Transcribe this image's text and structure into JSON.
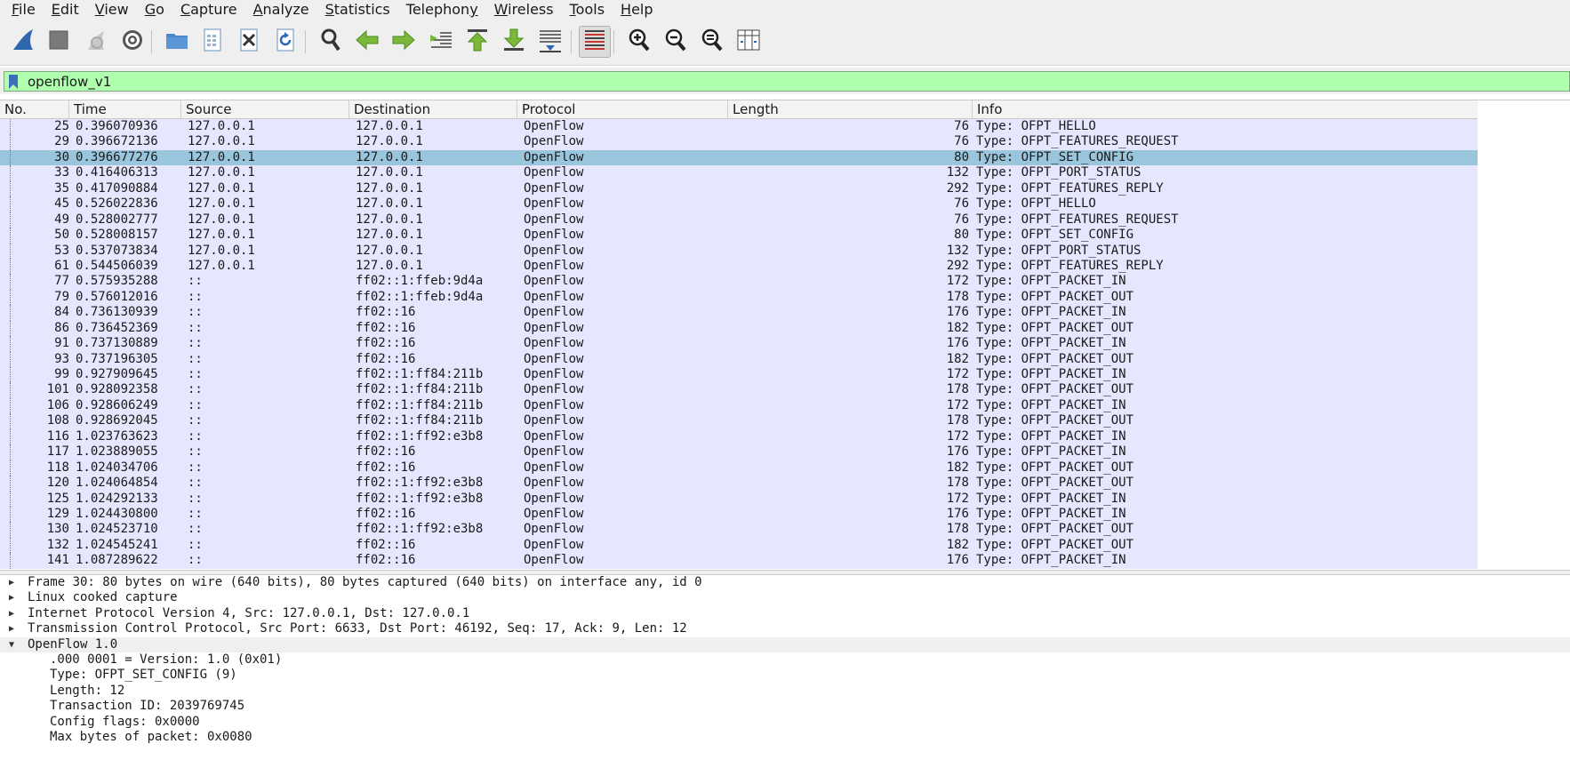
{
  "menu": [
    {
      "label": "File",
      "u": "F",
      "rest": "ile"
    },
    {
      "label": "Edit",
      "u": "E",
      "rest": "dit"
    },
    {
      "label": "View",
      "u": "V",
      "rest": "iew"
    },
    {
      "label": "Go",
      "u": "G",
      "rest": "o"
    },
    {
      "label": "Capture",
      "u": "C",
      "rest": "apture"
    },
    {
      "label": "Analyze",
      "u": "A",
      "rest": "nalyze"
    },
    {
      "label": "Statistics",
      "u": "S",
      "rest": "tatistics"
    },
    {
      "label": "Telephony",
      "u": "y",
      "pre": "Telephon",
      "rest": ""
    },
    {
      "label": "Wireless",
      "u": "W",
      "rest": "ireless"
    },
    {
      "label": "Tools",
      "u": "T",
      "rest": "ools"
    },
    {
      "label": "Help",
      "u": "H",
      "rest": "elp"
    }
  ],
  "toolbar_icons": [
    "shark-fin-start-icon",
    "stop-icon",
    "restart-icon",
    "capture-options-icon",
    "open-file-icon",
    "save-file-icon",
    "close-file-icon",
    "reload-icon",
    "find-packet-icon",
    "go-back-icon",
    "go-forward-icon",
    "go-to-packet-icon",
    "first-packet-icon",
    "last-packet-icon",
    "autoscroll-icon",
    "colorize-icon",
    "zoom-in-icon",
    "zoom-out-icon",
    "normal-size-icon",
    "resize-columns-icon"
  ],
  "filter": {
    "value": "openflow_v1"
  },
  "columns": [
    "No.",
    "Time",
    "Source",
    "Destination",
    "Protocol",
    "Length",
    "Info"
  ],
  "packets": [
    {
      "no": "25",
      "time": "0.396070936",
      "src": "127.0.0.1",
      "dst": "127.0.0.1",
      "proto": "OpenFlow",
      "len": "76",
      "info": "Type: OFPT_HELLO"
    },
    {
      "no": "29",
      "time": "0.396672136",
      "src": "127.0.0.1",
      "dst": "127.0.0.1",
      "proto": "OpenFlow",
      "len": "76",
      "info": "Type: OFPT_FEATURES_REQUEST"
    },
    {
      "no": "30",
      "time": "0.396677276",
      "src": "127.0.0.1",
      "dst": "127.0.0.1",
      "proto": "OpenFlow",
      "len": "80",
      "info": "Type: OFPT_SET_CONFIG",
      "selected": true
    },
    {
      "no": "33",
      "time": "0.416406313",
      "src": "127.0.0.1",
      "dst": "127.0.0.1",
      "proto": "OpenFlow",
      "len": "132",
      "info": "Type: OFPT_PORT_STATUS"
    },
    {
      "no": "35",
      "time": "0.417090884",
      "src": "127.0.0.1",
      "dst": "127.0.0.1",
      "proto": "OpenFlow",
      "len": "292",
      "info": "Type: OFPT_FEATURES_REPLY"
    },
    {
      "no": "45",
      "time": "0.526022836",
      "src": "127.0.0.1",
      "dst": "127.0.0.1",
      "proto": "OpenFlow",
      "len": "76",
      "info": "Type: OFPT_HELLO"
    },
    {
      "no": "49",
      "time": "0.528002777",
      "src": "127.0.0.1",
      "dst": "127.0.0.1",
      "proto": "OpenFlow",
      "len": "76",
      "info": "Type: OFPT_FEATURES_REQUEST"
    },
    {
      "no": "50",
      "time": "0.528008157",
      "src": "127.0.0.1",
      "dst": "127.0.0.1",
      "proto": "OpenFlow",
      "len": "80",
      "info": "Type: OFPT_SET_CONFIG"
    },
    {
      "no": "53",
      "time": "0.537073834",
      "src": "127.0.0.1",
      "dst": "127.0.0.1",
      "proto": "OpenFlow",
      "len": "132",
      "info": "Type: OFPT_PORT_STATUS"
    },
    {
      "no": "61",
      "time": "0.544506039",
      "src": "127.0.0.1",
      "dst": "127.0.0.1",
      "proto": "OpenFlow",
      "len": "292",
      "info": "Type: OFPT_FEATURES_REPLY"
    },
    {
      "no": "77",
      "time": "0.575935288",
      "src": "::",
      "dst": "ff02::1:ffeb:9d4a",
      "proto": "OpenFlow",
      "len": "172",
      "info": "Type: OFPT_PACKET_IN"
    },
    {
      "no": "79",
      "time": "0.576012016",
      "src": "::",
      "dst": "ff02::1:ffeb:9d4a",
      "proto": "OpenFlow",
      "len": "178",
      "info": "Type: OFPT_PACKET_OUT"
    },
    {
      "no": "84",
      "time": "0.736130939",
      "src": "::",
      "dst": "ff02::16",
      "proto": "OpenFlow",
      "len": "176",
      "info": "Type: OFPT_PACKET_IN"
    },
    {
      "no": "86",
      "time": "0.736452369",
      "src": "::",
      "dst": "ff02::16",
      "proto": "OpenFlow",
      "len": "182",
      "info": "Type: OFPT_PACKET_OUT"
    },
    {
      "no": "91",
      "time": "0.737130889",
      "src": "::",
      "dst": "ff02::16",
      "proto": "OpenFlow",
      "len": "176",
      "info": "Type: OFPT_PACKET_IN"
    },
    {
      "no": "93",
      "time": "0.737196305",
      "src": "::",
      "dst": "ff02::16",
      "proto": "OpenFlow",
      "len": "182",
      "info": "Type: OFPT_PACKET_OUT"
    },
    {
      "no": "99",
      "time": "0.927909645",
      "src": "::",
      "dst": "ff02::1:ff84:211b",
      "proto": "OpenFlow",
      "len": "172",
      "info": "Type: OFPT_PACKET_IN"
    },
    {
      "no": "101",
      "time": "0.928092358",
      "src": "::",
      "dst": "ff02::1:ff84:211b",
      "proto": "OpenFlow",
      "len": "178",
      "info": "Type: OFPT_PACKET_OUT"
    },
    {
      "no": "106",
      "time": "0.928606249",
      "src": "::",
      "dst": "ff02::1:ff84:211b",
      "proto": "OpenFlow",
      "len": "172",
      "info": "Type: OFPT_PACKET_IN"
    },
    {
      "no": "108",
      "time": "0.928692045",
      "src": "::",
      "dst": "ff02::1:ff84:211b",
      "proto": "OpenFlow",
      "len": "178",
      "info": "Type: OFPT_PACKET_OUT"
    },
    {
      "no": "116",
      "time": "1.023763623",
      "src": "::",
      "dst": "ff02::1:ff92:e3b8",
      "proto": "OpenFlow",
      "len": "172",
      "info": "Type: OFPT_PACKET_IN"
    },
    {
      "no": "117",
      "time": "1.023889055",
      "src": "::",
      "dst": "ff02::16",
      "proto": "OpenFlow",
      "len": "176",
      "info": "Type: OFPT_PACKET_IN"
    },
    {
      "no": "118",
      "time": "1.024034706",
      "src": "::",
      "dst": "ff02::16",
      "proto": "OpenFlow",
      "len": "182",
      "info": "Type: OFPT_PACKET_OUT"
    },
    {
      "no": "120",
      "time": "1.024064854",
      "src": "::",
      "dst": "ff02::1:ff92:e3b8",
      "proto": "OpenFlow",
      "len": "178",
      "info": "Type: OFPT_PACKET_OUT"
    },
    {
      "no": "125",
      "time": "1.024292133",
      "src": "::",
      "dst": "ff02::1:ff92:e3b8",
      "proto": "OpenFlow",
      "len": "172",
      "info": "Type: OFPT_PACKET_IN"
    },
    {
      "no": "129",
      "time": "1.024430800",
      "src": "::",
      "dst": "ff02::16",
      "proto": "OpenFlow",
      "len": "176",
      "info": "Type: OFPT_PACKET_IN"
    },
    {
      "no": "130",
      "time": "1.024523710",
      "src": "::",
      "dst": "ff02::1:ff92:e3b8",
      "proto": "OpenFlow",
      "len": "178",
      "info": "Type: OFPT_PACKET_OUT"
    },
    {
      "no": "132",
      "time": "1.024545241",
      "src": "::",
      "dst": "ff02::16",
      "proto": "OpenFlow",
      "len": "182",
      "info": "Type: OFPT_PACKET_OUT"
    },
    {
      "no": "141",
      "time": "1.087289622",
      "src": "::",
      "dst": "ff02::16",
      "proto": "OpenFlow",
      "len": "176",
      "info": "Type: OFPT_PACKET_IN"
    }
  ],
  "details": [
    {
      "text": "Frame 30: 80 bytes on wire (640 bits), 80 bytes captured (640 bits) on interface any, id 0",
      "state": "collapsed"
    },
    {
      "text": "Linux cooked capture",
      "state": "collapsed"
    },
    {
      "text": "Internet Protocol Version 4, Src: 127.0.0.1, Dst: 127.0.0.1",
      "state": "collapsed"
    },
    {
      "text": "Transmission Control Protocol, Src Port: 6633, Dst Port: 46192, Seq: 17, Ack: 9, Len: 12",
      "state": "collapsed"
    },
    {
      "text": "OpenFlow 1.0",
      "state": "expanded"
    },
    {
      "text": ".000 0001 = Version: 1.0 (0x01)",
      "state": "child"
    },
    {
      "text": "Type: OFPT_SET_CONFIG (9)",
      "state": "child"
    },
    {
      "text": "Length: 12",
      "state": "child"
    },
    {
      "text": "Transaction ID: 2039769745",
      "state": "child"
    },
    {
      "text": "Config flags: 0x0000",
      "state": "child"
    },
    {
      "text": "Max bytes of packet: 0x0080",
      "state": "child"
    }
  ],
  "colors": {
    "filter_valid": "#afffaf",
    "row_tcp": "#e7e6ff",
    "row_selected": "#9ac6dd",
    "accent_blue": "#3c6fb8"
  }
}
